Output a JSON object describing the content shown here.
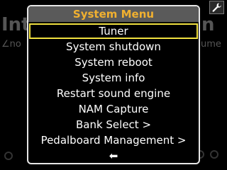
{
  "background": {
    "title_left": "Int",
    "title_right": "n",
    "sub_left": "∠no",
    "sub_right": "ume"
  },
  "wrench_icon": "wrench-icon",
  "menu": {
    "title": "System Menu",
    "items": [
      {
        "label": "Tuner",
        "selected": true
      },
      {
        "label": "System shutdown"
      },
      {
        "label": "System reboot"
      },
      {
        "label": "System info"
      },
      {
        "label": "Restart sound engine"
      },
      {
        "label": "NAM Capture"
      },
      {
        "label": "Bank Select >"
      },
      {
        "label": "Pedalboard Management >"
      },
      {
        "label": "⬅"
      }
    ]
  },
  "colors": {
    "title": "#f0b030",
    "selection_border": "#f0e040",
    "menu_border": "#e6e6e6",
    "header_bg": "#5a5a5a"
  }
}
